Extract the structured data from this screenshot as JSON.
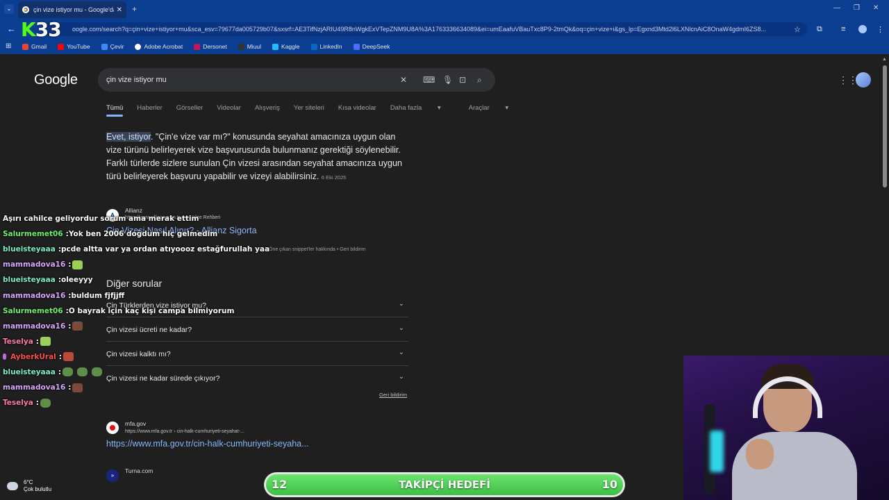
{
  "browser": {
    "tab_title": "çin vize istiyor mu - Google'da A",
    "url": "oogle.com/search?q=çin+vize+istiyor+mu&sca_esv=79677da005729b07&sxsrf=AE3TifNzjARIU49R8nWgkExVTepZNM9U8A%3A1763336634089&ei=umEaafuVBauTxc8P9-2tmQk&oq=çin+vize+i&gs_lp=Egxnd3Mtd2l6LXNlcnAiC8OnaW4gdmI6ZS8...",
    "logo_text": "33",
    "logo_letter": "K"
  },
  "bookmarks": [
    {
      "label": "Gmail",
      "color": "#ea4335"
    },
    {
      "label": "YouTube",
      "color": "#ff0000"
    },
    {
      "label": "Çevir",
      "color": "#4285f4"
    },
    {
      "label": "Adobe Acrobat",
      "color": "#ffffff"
    },
    {
      "label": "Dersonet",
      "color": "#c2185b"
    },
    {
      "label": "Miuul",
      "color": "#333333"
    },
    {
      "label": "Kaggle",
      "color": "#20beff"
    },
    {
      "label": "LinkedIn",
      "color": "#0a66c2"
    },
    {
      "label": "DeepSeek",
      "color": "#4d6bfe"
    }
  ],
  "google": {
    "logo": "Google",
    "query": "çin vize istiyor mu",
    "tabs": [
      "Tümü",
      "Haberler",
      "Görseller",
      "Videolar",
      "Alışveriş",
      "Yer siteleri",
      "Kısa videolar",
      "Daha fazla",
      "Araçlar"
    ],
    "snippet_highlight": "Evet, istiyor",
    "snippet_text": ". \"Çin'e vize var mı?\" konusunda seyahat amacınıza uygun olan vize türünü belirleyerek vize başvurusunda bulunmanız gerektiği söylenebilir. Farklı türlerde sizlere sunulan Çin vizesi arasından seyahat amacınıza uygun türü belirleyerek başvuru yapabilir ve vizeyi alabilirsiniz.",
    "snippet_date": "6 Eki 2025",
    "source_name": "Allianz",
    "source_url": "https://www.allianz.com.tr › ... › Vize Rehberi",
    "source_link": "Çin Vizesi Nasıl Alınır? - Allianz Sigorta",
    "snippet_meta": "Öne çıkan snippet'ler hakkında  •  Geri bildirim",
    "paa_title": "Diğer sorular",
    "paa": [
      "Çin Türklerden vize istiyor mu?",
      "Çin vizesi ücreti ne kadar?",
      "Çin vizesi kalktı mı?",
      "Çin vizesi ne kadar sürede çıkıyor?"
    ],
    "feedback": "Geri bildirim",
    "result2_name": "mfa.gov",
    "result2_url": "https://www.mfa.gov.tr › cin-halk-cumhuriyeti-seyahat-...",
    "result2_link": "https://www.mfa.gov.tr/cin-halk-cumhuriyeti-seyaha...",
    "result3_name": "Turna.com"
  },
  "chat": [
    {
      "user": "",
      "text": "Aşırı cahilce geliyordur sorum ama merak ettim",
      "color": "#ffffff",
      "emotes": []
    },
    {
      "user": "Salurmemet06",
      "text": "Yok ben 2006 doğdum hiç gelmedim",
      "color": "#6df06d",
      "emotes": []
    },
    {
      "user": "blueisteyaaa",
      "text": "pcde altta var ya ordan atıyoooz estağfurullah yaa",
      "color": "#7ef0c8",
      "emotes": []
    },
    {
      "user": "mammadova16",
      "text": "",
      "color": "#d8a8ff",
      "emotes": [
        "frog"
      ]
    },
    {
      "user": "blueisteyaaa",
      "text": "oleeyyy",
      "color": "#7ef0c8",
      "emotes": []
    },
    {
      "user": "mammadova16",
      "text": "buldum fjfjjff",
      "color": "#d8a8ff",
      "emotes": []
    },
    {
      "user": "Salurmemet06",
      "text": "O bayrak için kaç kişi campa bilmiyorum",
      "color": "#6df06d",
      "emotes": []
    },
    {
      "user": "mammadova16",
      "text": "",
      "color": "#d8a8ff",
      "emotes": [
        "brown"
      ]
    },
    {
      "user": "Teselya",
      "text": "",
      "color": "#ff7ab0",
      "emotes": [
        "frog"
      ]
    },
    {
      "user": "AyberkUral",
      "text": "",
      "color": "#ff4f4f",
      "emotes": [
        "red"
      ],
      "mic": true
    },
    {
      "user": "blueisteyaaa",
      "text": "",
      "color": "#7ef0c8",
      "emotes": [
        "pepe",
        "pepe",
        "pepe"
      ]
    },
    {
      "user": "mammadova16",
      "text": "",
      "color": "#d8a8ff",
      "emotes": [
        "brown"
      ]
    },
    {
      "user": "Teselya",
      "text": "",
      "color": "#ff7ab0",
      "emotes": [
        "pepe"
      ]
    }
  ],
  "goal": {
    "label": "TAKİPÇİ HEDEFİ",
    "current": "12",
    "target": "10"
  },
  "weather": {
    "temp": "6°C",
    "desc": "Çok bulutlu"
  }
}
